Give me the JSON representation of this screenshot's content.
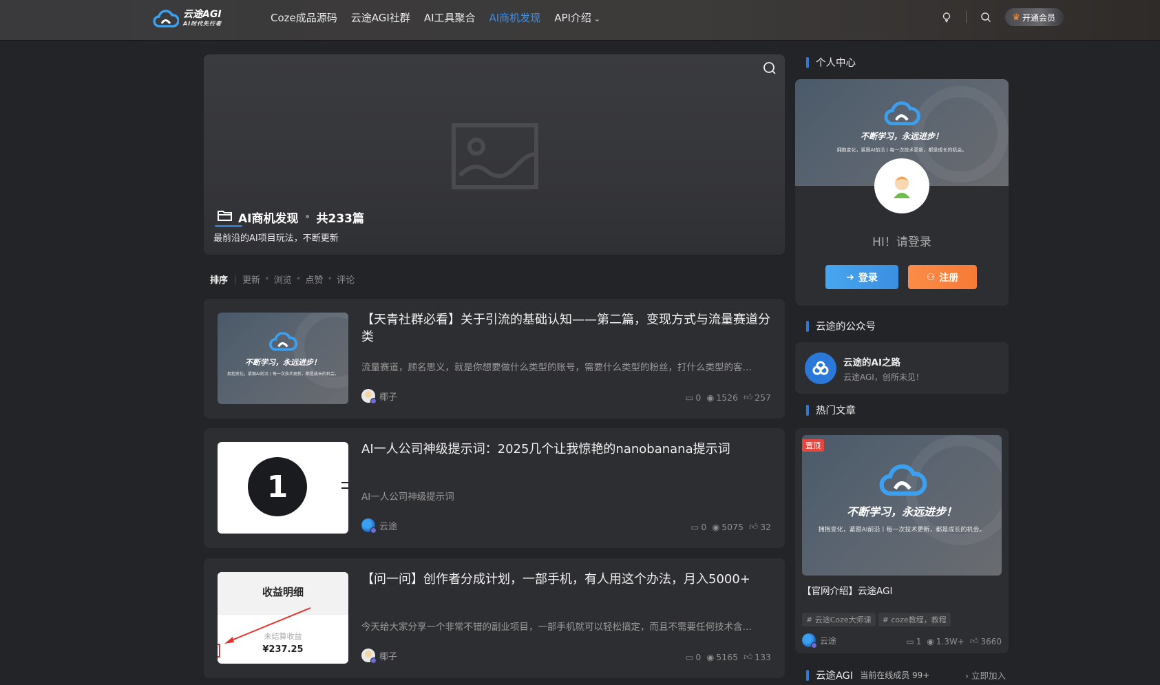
{
  "header": {
    "logo_text": "云途AGI",
    "logo_sub": "AI时代先行者",
    "nav": [
      {
        "label": "Coze成品源码"
      },
      {
        "label": "云途AGI社群"
      },
      {
        "label": "AI工具聚合"
      },
      {
        "label": "AI商机发现"
      },
      {
        "label": "API介绍"
      }
    ],
    "vip_label": "开通会员"
  },
  "banner": {
    "title": "AI商机发现",
    "count": "共233篇",
    "desc": "最前沿的AI项目玩法，不断更新"
  },
  "sort": {
    "label": "排序",
    "options": [
      "更新",
      "浏览",
      "点赞",
      "评论"
    ]
  },
  "brand": {
    "slogan": "不断学习，永远进步！",
    "sub": "拥抱变化，紧跟AI前沿丨每一次技术更新，都是成长的机会。"
  },
  "posts": [
    {
      "title": "【天青社群必看】关于引流的基础认知——第二篇，变现方式与流量赛道分类",
      "excerpt": "流量赛道，顾名思义，就是你想要做什么类型的账号，需要什么类型的粉丝，打什么类型的客…",
      "author": "椰子",
      "comments": "0",
      "views": "1526",
      "likes": "257"
    },
    {
      "title": "AI一人公司神级提示词：2025几个让我惊艳的nanobanana提示词",
      "excerpt": "AI一人公司神级提示词",
      "author": "云途",
      "comments": "0",
      "views": "5075",
      "likes": "32",
      "thumb_number": "1"
    },
    {
      "title": "【问一问】创作者分成计划，一部手机，有人用这个办法，月入5000+",
      "excerpt": "今天给大家分享一个非常不错的副业项目，一部手机就可以轻松搞定，而且不需要任何技术含…",
      "author": "椰子",
      "comments": "0",
      "views": "5165",
      "likes": "133",
      "thumb_heading": "收益明细",
      "thumb_label": "未结算收益",
      "thumb_amount": "¥237.25"
    }
  ],
  "sidebar": {
    "personal_title": "个人中心",
    "hi": "HI！请登录",
    "login_label": "登录",
    "register_label": "注册",
    "wechat_title": "云途的公众号",
    "wechat_name": "云途的AI之路",
    "wechat_desc": "云途AGI，创所未见！",
    "hot_title": "热门文章",
    "hot_badge": "置顶",
    "hot_article_title": "【官网介绍】云途AGI",
    "hot_tags": [
      "# 云途Coze大师课",
      "# coze教程，教程"
    ],
    "hot_author": "云途",
    "hot_comments": "1",
    "hot_views": "1.3W+",
    "hot_likes": "3660",
    "group_title": "云途AGI",
    "group_online": "当前在线成员 99+",
    "group_join": "立即加入"
  }
}
